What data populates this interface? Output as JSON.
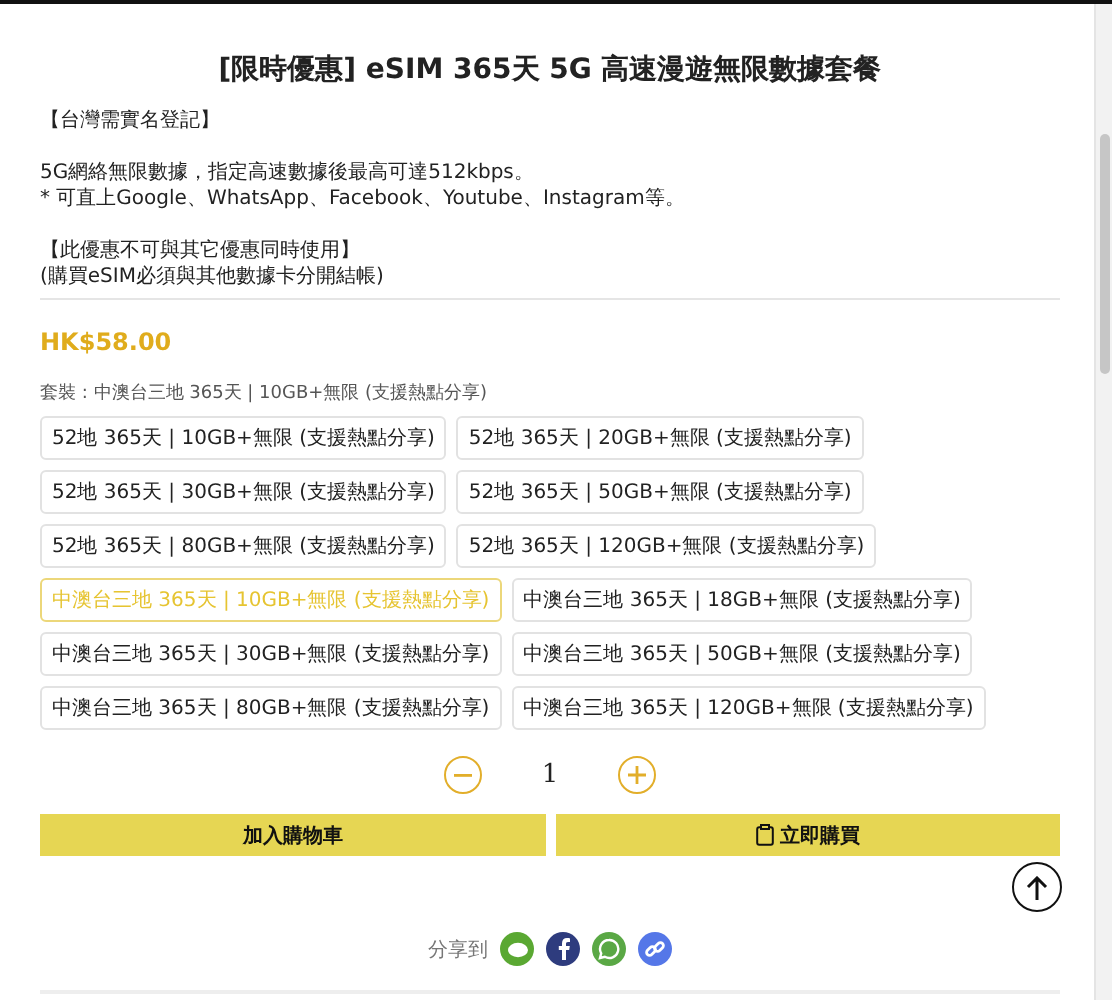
{
  "title": "[限時優惠] eSIM 365天 5G 高速漫遊無限數據套餐",
  "description": [
    [
      "【台灣需實名登記】"
    ],
    [
      "5G網絡無限數據，指定高速數據後最高可達512kbps。",
      "* 可直上Google、WhatsApp、Facebook、Youtube、Instagram等。"
    ],
    [
      "【此優惠不可與其它優惠同時使用】",
      "(購買eSIM必須與其他數據卡分開結帳)"
    ]
  ],
  "price": "HK$58.00",
  "variant_label": "套裝 : 中澳台三地 365天 | 10GB+無限 (支援熱點分享)",
  "options": [
    {
      "label": "52地 365天 | 10GB+無限 (支援熱點分享)",
      "selected": false
    },
    {
      "label": "52地 365天 | 20GB+無限 (支援熱點分享)",
      "selected": false
    },
    {
      "label": "52地 365天 | 30GB+無限 (支援熱點分享)",
      "selected": false
    },
    {
      "label": "52地 365天 | 50GB+無限 (支援熱點分享)",
      "selected": false
    },
    {
      "label": "52地 365天 | 80GB+無限 (支援熱點分享)",
      "selected": false
    },
    {
      "label": "52地 365天 | 120GB+無限 (支援熱點分享)",
      "selected": false
    },
    {
      "label": "中澳台三地 365天 | 10GB+無限 (支援熱點分享)",
      "selected": true
    },
    {
      "label": "中澳台三地 365天 | 18GB+無限 (支援熱點分享)",
      "selected": false
    },
    {
      "label": "中澳台三地 365天 | 30GB+無限 (支援熱點分享)",
      "selected": false
    },
    {
      "label": "中澳台三地 365天 | 50GB+無限 (支援熱點分享)",
      "selected": false
    },
    {
      "label": "中澳台三地 365天 | 80GB+無限 (支援熱點分享)",
      "selected": false
    },
    {
      "label": "中澳台三地 365天 | 120GB+無限 (支援熱點分享)",
      "selected": false
    }
  ],
  "quantity": "1",
  "buttons": [
    {
      "label": "加入購物車",
      "kind": "cart"
    },
    {
      "label": "立即購買",
      "kind": "buy"
    }
  ],
  "share_label": "分享到",
  "share": [
    {
      "kind": "line",
      "color": "#5aa832"
    },
    {
      "kind": "facebook",
      "color": "#2e3c7e"
    },
    {
      "kind": "whatsapp",
      "color": "#5aa845"
    },
    {
      "kind": "link",
      "color": "#5577e8"
    }
  ]
}
